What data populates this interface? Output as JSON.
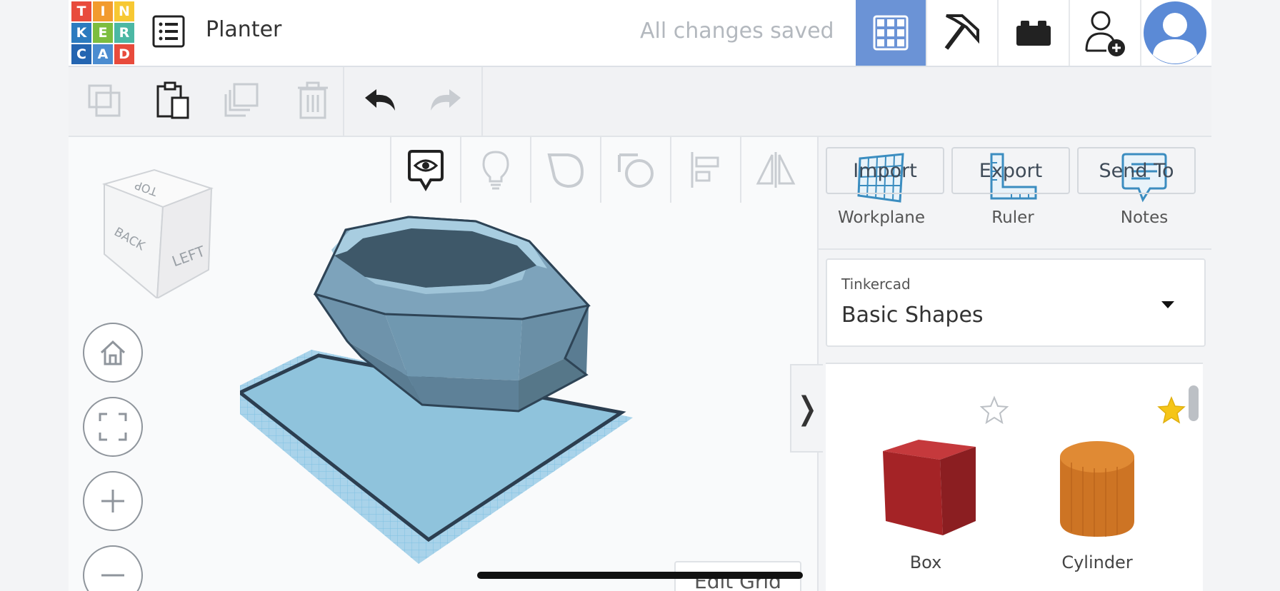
{
  "header": {
    "logo_letters": [
      "T",
      "I",
      "N",
      "K",
      "E",
      "R",
      "C",
      "A",
      "D"
    ],
    "logo_colors": [
      "#e84b3c",
      "#f29b2e",
      "#f7c833",
      "#2c7bbf",
      "#7cbd3f",
      "#4cb8a4",
      "#2465b1",
      "#4b8cd0",
      "#e84b3c"
    ],
    "title": "Planter",
    "status": "All changes saved",
    "icons": [
      "3d-design-icon",
      "codeblocks-icon",
      "bricks-icon",
      "invite-user-icon",
      "avatar"
    ],
    "accent": "#6b93d6"
  },
  "panel": {
    "import_label": "Import",
    "export_label": "Export",
    "sendto_label": "Send To",
    "workplane_label": "Workplane",
    "ruler_label": "Ruler",
    "notes_label": "Notes",
    "library_category": "Tinkercad",
    "library_value": "Basic Shapes",
    "shapes": [
      {
        "label": "Box",
        "color": "#b3272a",
        "favorite": false
      },
      {
        "label": "Cylinder",
        "color": "#d9822b",
        "favorite": true
      }
    ]
  },
  "viewcube": {
    "top": "TOP",
    "back": "BACK",
    "left": "LEFT"
  },
  "canvas": {
    "edit_grid_label": "Edit Grid",
    "collapse_glyph": "❭"
  }
}
